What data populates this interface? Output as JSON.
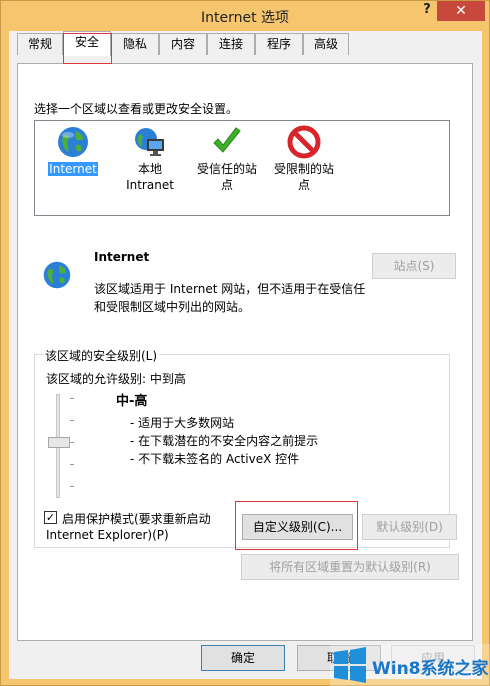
{
  "window": {
    "title": "Internet 选项",
    "help_glyph": "?",
    "close_glyph": "✕"
  },
  "tabs": [
    {
      "label": "常规"
    },
    {
      "label": "安全"
    },
    {
      "label": "隐私"
    },
    {
      "label": "内容"
    },
    {
      "label": "连接"
    },
    {
      "label": "程序"
    },
    {
      "label": "高级"
    }
  ],
  "security": {
    "select_zone_text": "选择一个区域以查看或更改安全设置。",
    "zones": [
      {
        "line1": "Internet",
        "line2": "",
        "icon": "globe-icon"
      },
      {
        "line1": "本地",
        "line2": "Intranet",
        "icon": "intranet-icon"
      },
      {
        "line1": "受信任的站",
        "line2": "点",
        "icon": "checkmark-icon"
      },
      {
        "line1": "受限制的站",
        "line2": "点",
        "icon": "restricted-icon"
      }
    ],
    "selected_zone": "Internet",
    "zone_name": "Internet",
    "zone_desc_line1": "该区域适用于 Internet 网站，但不适用于在受信任",
    "zone_desc_line2": "和受限制区域中列出的网站。",
    "sites_button": "站点(S)",
    "group_title": "该区域的安全级别(L)",
    "allowed_level": "该区域的允许级别: 中到高",
    "level_name": "中-高",
    "bullets": [
      "- 适用于大多数网站",
      "- 在下载潜在的不安全内容之前提示",
      "- 不下载未签名的 ActiveX 控件"
    ],
    "protected_mode_checked": true,
    "protected_mode_line1": "启用保护模式(要求重新启动",
    "protected_mode_line2": "Internet Explorer)(P)",
    "custom_level_button": "自定义级别(C)...",
    "default_level_button": "默认级别(D)",
    "reset_all_button": "将所有区域重置为默认级别(R)"
  },
  "footer": {
    "ok_button": "确定",
    "cancel_button": "取消",
    "apply_button": "应用"
  },
  "watermark": {
    "text": "Win8系统之家"
  },
  "colors": {
    "title_bar": "#f6c66f",
    "close_button": "#c9483c",
    "highlight_box": "#e0363d",
    "selection": "#3399ff"
  }
}
